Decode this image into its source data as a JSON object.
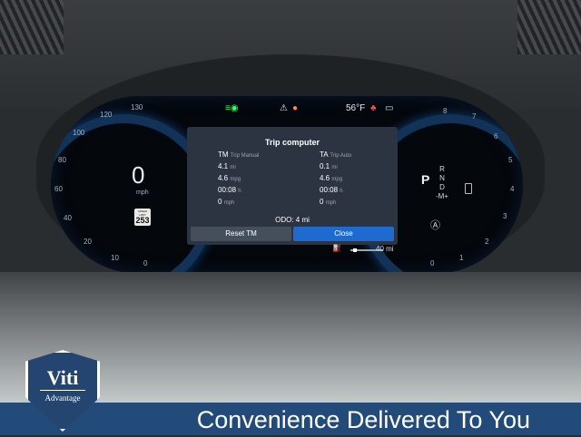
{
  "status": {
    "temperature": "56°F",
    "icon_names": [
      "headlight-icon",
      "warning-triangle-icon",
      "seatbelt-icon",
      "car-icon"
    ],
    "colors": {
      "green": "#37ff6b",
      "red": "#ff4d4d",
      "orange": "#ff8a38"
    }
  },
  "speedometer": {
    "speed": "0",
    "unit": "mph",
    "ticks": [
      "130",
      "120",
      "100",
      "80",
      "60",
      "40",
      "20",
      "10",
      "0"
    ],
    "speed_limit_label": "SPEED LIMIT",
    "speed_limit": "253"
  },
  "tachometer": {
    "ticks": [
      "8",
      "7",
      "6",
      "5",
      "4",
      "3",
      "2",
      "1",
      "0"
    ]
  },
  "gear": {
    "current": "P",
    "list": [
      "R",
      "N",
      "D",
      "-M+"
    ]
  },
  "trip_computer": {
    "title": "Trip computer",
    "tm": {
      "code": "TM",
      "label": "Trip Manual",
      "rows": [
        {
          "value": "4.1",
          "unit": "mi"
        },
        {
          "value": "4.6",
          "unit": "mpg"
        },
        {
          "value": "00:08",
          "unit": "h"
        },
        {
          "value": "0",
          "unit": "mph"
        }
      ]
    },
    "ta": {
      "code": "TA",
      "label": "Trip Auto",
      "rows": [
        {
          "value": "0.1",
          "unit": "mi"
        },
        {
          "value": "4.6",
          "unit": "mpg"
        },
        {
          "value": "00:08",
          "unit": "h"
        },
        {
          "value": "0",
          "unit": "mph"
        }
      ]
    },
    "odo": "ODO: 4 mi",
    "reset_label": "Reset TM",
    "close_label": "Close"
  },
  "range": {
    "value": "40 mi",
    "progress_fraction": 0.1
  },
  "banner": {
    "text": "Convenience Delivered To You"
  },
  "logo": {
    "name": "Viti",
    "subtitle": "Advantage"
  }
}
